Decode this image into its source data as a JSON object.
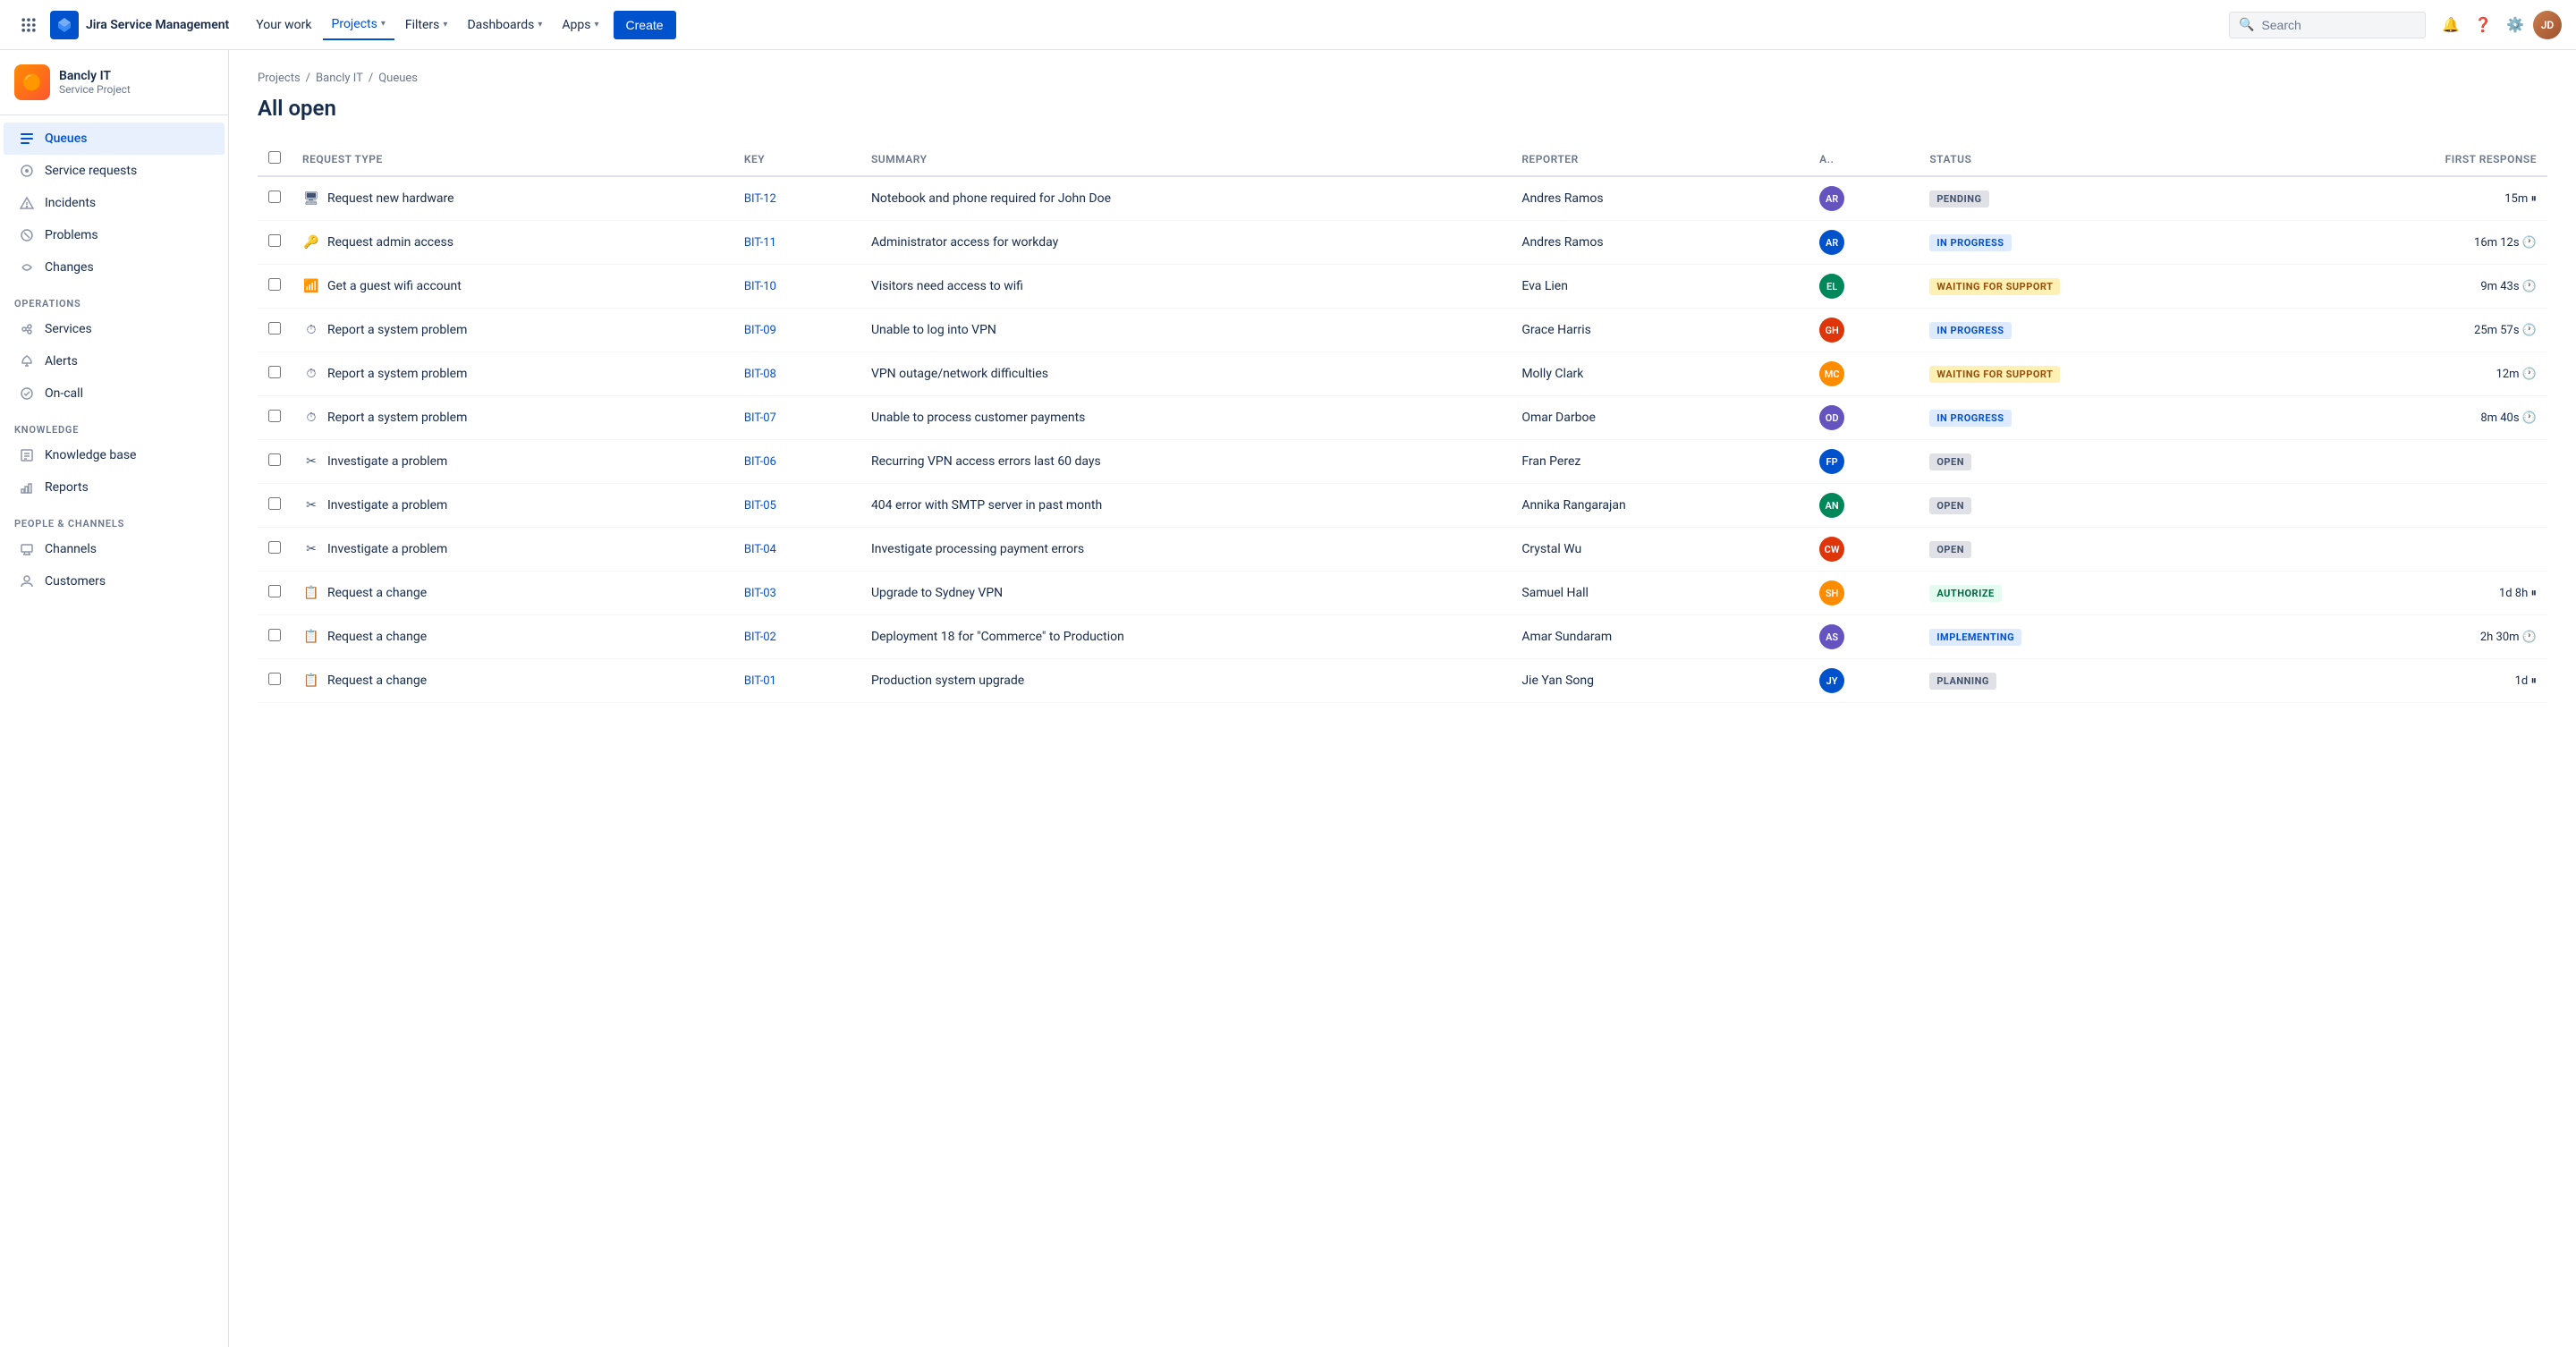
{
  "app": {
    "name": "Jira Service Management"
  },
  "topnav": {
    "your_work": "Your work",
    "projects": "Projects",
    "filters": "Filters",
    "dashboards": "Dashboards",
    "apps": "Apps",
    "create": "Create",
    "search_placeholder": "Search"
  },
  "sidebar": {
    "project_name": "Bancly IT",
    "project_type": "Service Project",
    "project_icon": "🟠",
    "nav_items": [
      {
        "id": "queues",
        "label": "Queues",
        "active": true
      },
      {
        "id": "service-requests",
        "label": "Service requests",
        "active": false
      },
      {
        "id": "incidents",
        "label": "Incidents",
        "active": false
      },
      {
        "id": "problems",
        "label": "Problems",
        "active": false
      },
      {
        "id": "changes",
        "label": "Changes",
        "active": false
      }
    ],
    "operations_section": "Operations",
    "operations_items": [
      {
        "id": "services",
        "label": "Services"
      },
      {
        "id": "alerts",
        "label": "Alerts"
      },
      {
        "id": "on-call",
        "label": "On-call"
      }
    ],
    "knowledge_section": "Knowledge",
    "knowledge_items": [
      {
        "id": "knowledge-base",
        "label": "Knowledge base"
      },
      {
        "id": "reports",
        "label": "Reports"
      }
    ],
    "people_section": "People & Channels",
    "people_items": [
      {
        "id": "channels",
        "label": "Channels"
      },
      {
        "id": "customers",
        "label": "Customers"
      }
    ]
  },
  "breadcrumb": {
    "items": [
      "Projects",
      "Bancly IT",
      "Queues"
    ]
  },
  "page": {
    "title": "All open"
  },
  "table": {
    "columns": [
      "Request Type",
      "Key",
      "Summary",
      "Reporter",
      "A..",
      "Status",
      "First response"
    ],
    "rows": [
      {
        "request_type": "Request new hardware",
        "rt_icon": "hardware",
        "key": "BIT-12",
        "summary": "Notebook and phone required for John Doe",
        "reporter": "Andres Ramos",
        "av_class": "av-0",
        "av_initials": "AR",
        "status": "PENDING",
        "status_class": "status-pending",
        "first_response": "15m",
        "first_response_icon": "pause"
      },
      {
        "request_type": "Request admin access",
        "rt_icon": "key",
        "key": "BIT-11",
        "summary": "Administrator access for workday",
        "reporter": "Andres Ramos",
        "av_class": "av-1",
        "av_initials": "AR",
        "status": "IN PROGRESS",
        "status_class": "status-in-progress",
        "first_response": "16m 12s",
        "first_response_icon": "clock"
      },
      {
        "request_type": "Get a guest wifi account",
        "rt_icon": "wifi",
        "key": "BIT-10",
        "summary": "Visitors need access to wifi",
        "reporter": "Eva Lien",
        "av_class": "av-2",
        "av_initials": "EL",
        "status": "WAITING FOR SUPPORT",
        "status_class": "status-waiting",
        "first_response": "9m 43s",
        "first_response_icon": "clock"
      },
      {
        "request_type": "Report a system problem",
        "rt_icon": "problem",
        "key": "BIT-09",
        "summary": "Unable to log into VPN",
        "reporter": "Grace Harris",
        "av_class": "av-3",
        "av_initials": "GH",
        "status": "IN PROGRESS",
        "status_class": "status-in-progress",
        "first_response": "25m 57s",
        "first_response_icon": "clock"
      },
      {
        "request_type": "Report a system problem",
        "rt_icon": "problem",
        "key": "BIT-08",
        "summary": "VPN outage/network difficulties",
        "reporter": "Molly Clark",
        "av_class": "av-4",
        "av_initials": "MC",
        "status": "WAITING FOR SUPPORT",
        "status_class": "status-waiting",
        "first_response": "12m",
        "first_response_icon": "clock"
      },
      {
        "request_type": "Report a system problem",
        "rt_icon": "problem",
        "key": "BIT-07",
        "summary": "Unable to process customer payments",
        "reporter": "Omar Darboe",
        "av_class": "av-5",
        "av_initials": "OD",
        "status": "IN PROGRESS",
        "status_class": "status-in-progress",
        "first_response": "8m 40s",
        "first_response_icon": "clock"
      },
      {
        "request_type": "Investigate a problem",
        "rt_icon": "investigate",
        "key": "BIT-06",
        "summary": "Recurring VPN access errors last 60 days",
        "reporter": "Fran Perez",
        "av_class": "av-6",
        "av_initials": "FP",
        "status": "OPEN",
        "status_class": "status-open",
        "first_response": "",
        "first_response_icon": ""
      },
      {
        "request_type": "Investigate a problem",
        "rt_icon": "investigate",
        "key": "BIT-05",
        "summary": "404 error with SMTP server in past month",
        "reporter": "Annika Rangarajan",
        "av_class": "av-7",
        "av_initials": "AN",
        "status": "OPEN",
        "status_class": "status-open",
        "first_response": "",
        "first_response_icon": ""
      },
      {
        "request_type": "Investigate a problem",
        "rt_icon": "investigate",
        "key": "BIT-04",
        "summary": "Investigate processing payment errors",
        "reporter": "Crystal Wu",
        "av_class": "av-8",
        "av_initials": "CW",
        "status": "OPEN",
        "status_class": "status-open",
        "first_response": "",
        "first_response_icon": ""
      },
      {
        "request_type": "Request a change",
        "rt_icon": "change",
        "key": "BIT-03",
        "summary": "Upgrade to Sydney VPN",
        "reporter": "Samuel Hall",
        "av_class": "av-9",
        "av_initials": "SH",
        "status": "AUTHORIZE",
        "status_class": "status-authorize",
        "first_response": "1d 8h",
        "first_response_icon": "pause"
      },
      {
        "request_type": "Request a change",
        "rt_icon": "change",
        "key": "BIT-02",
        "summary": "Deployment 18 for \"Commerce\" to Production",
        "reporter": "Amar Sundaram",
        "av_class": "av-10",
        "av_initials": "AS",
        "status": "IMPLEMENTING",
        "status_class": "status-implementing",
        "first_response": "2h 30m",
        "first_response_icon": "clock"
      },
      {
        "request_type": "Request a change",
        "rt_icon": "change",
        "key": "BIT-01",
        "summary": "Production system upgrade",
        "reporter": "Jie Yan Song",
        "av_class": "av-11",
        "av_initials": "JY",
        "status": "PLANNING",
        "status_class": "status-planning",
        "first_response": "1d",
        "first_response_icon": "pause"
      }
    ]
  }
}
